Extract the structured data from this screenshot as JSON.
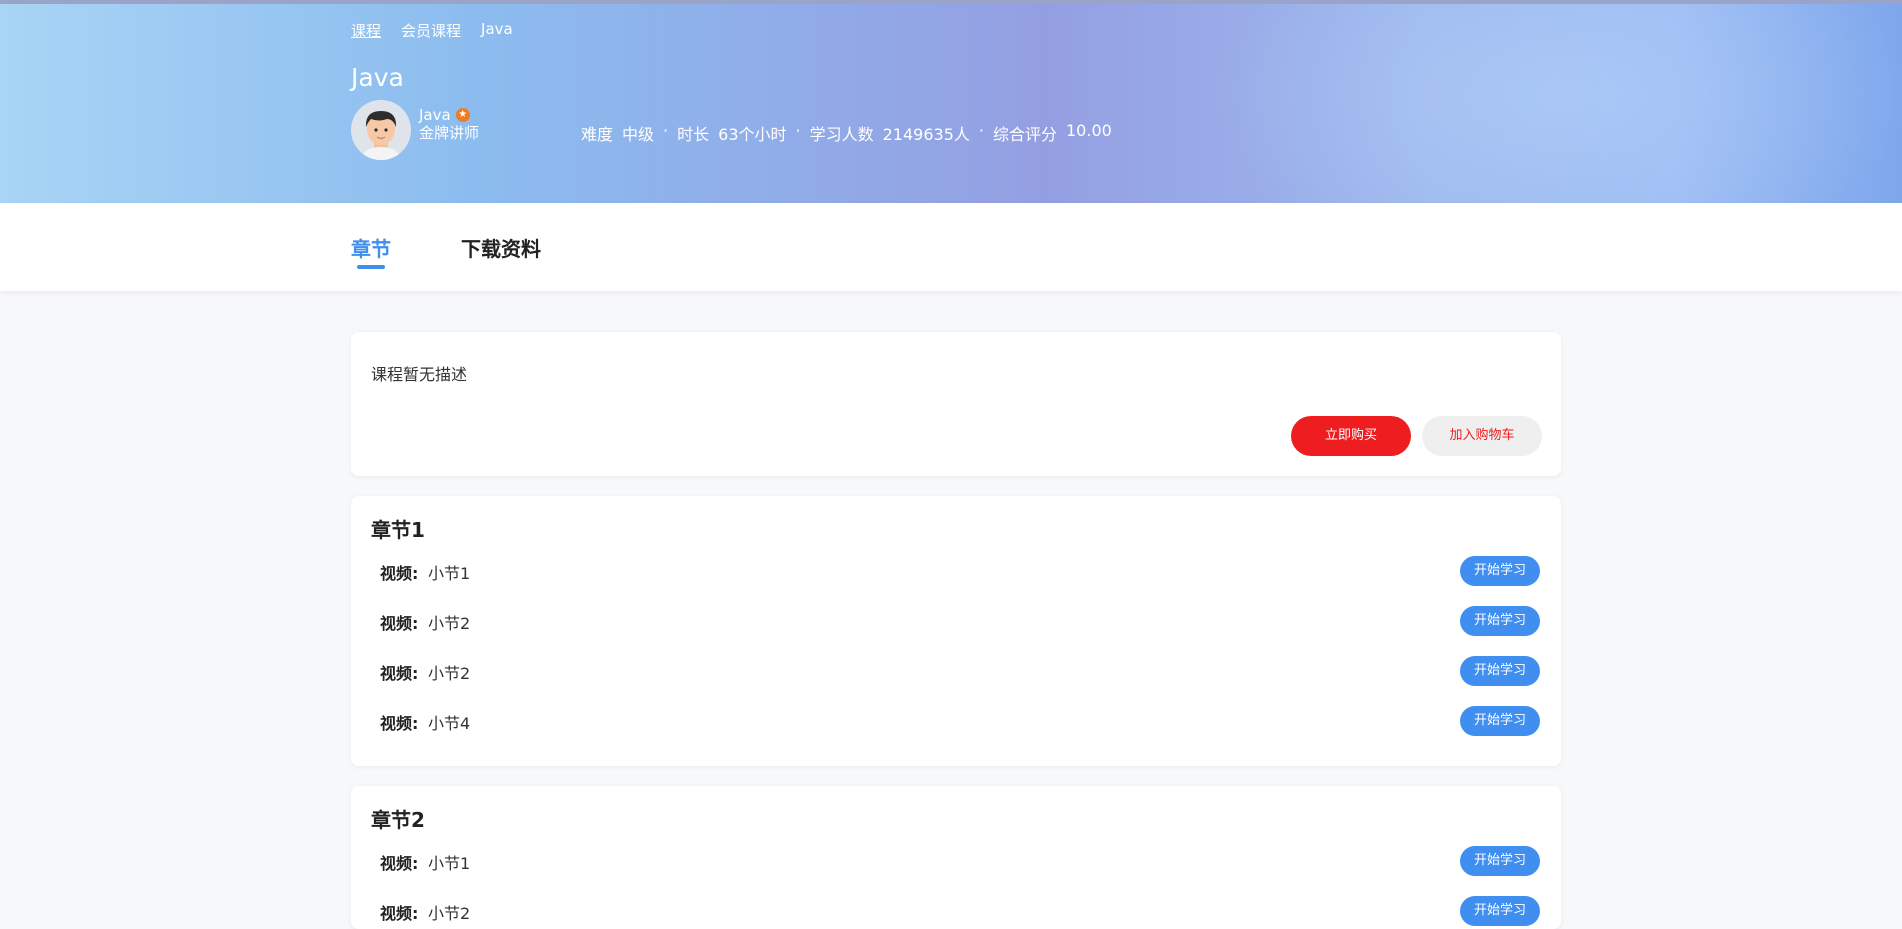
{
  "breadcrumb": [
    "课程",
    "会员课程",
    "Java"
  ],
  "course": {
    "title": "Java",
    "teacher_name": "Java",
    "teacher_title": "金牌讲师",
    "stats": {
      "difficulty_label": "难度",
      "difficulty": "中级",
      "duration_label": "时长",
      "duration": "63个小时",
      "learners_label": "学习人数",
      "learners": "2149635人",
      "rating_label": "综合评分",
      "rating": "10.00",
      "separator": "·"
    }
  },
  "tabs": [
    {
      "label": "章节",
      "active": true
    },
    {
      "label": "下载资料",
      "active": false
    }
  ],
  "description": {
    "text": "课程暂无描述",
    "buy_label": "立即购买",
    "cart_label": "加入购物车"
  },
  "chapters": [
    {
      "title": "章节1",
      "lessons": [
        {
          "kind": "视频:",
          "name": "小节1",
          "button": "开始学习"
        },
        {
          "kind": "视频:",
          "name": "小节2",
          "button": "开始学习"
        },
        {
          "kind": "视频:",
          "name": "小节2",
          "button": "开始学习"
        },
        {
          "kind": "视频:",
          "name": "小节4",
          "button": "开始学习"
        }
      ]
    },
    {
      "title": "章节2",
      "lessons": [
        {
          "kind": "视频:",
          "name": "小节1",
          "button": "开始学习"
        },
        {
          "kind": "视频:",
          "name": "小节2",
          "button": "开始学习"
        }
      ]
    }
  ],
  "colors": {
    "accent_blue": "#3f8ef0",
    "buy_red": "#ee1d1f",
    "teacher_badge": "#f07c1f"
  }
}
